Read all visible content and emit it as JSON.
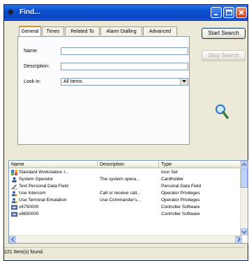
{
  "window": {
    "title": "Find..."
  },
  "tabs": [
    "General",
    "Times",
    "Related To",
    "Alarm Dialling",
    "Advanced"
  ],
  "form": {
    "name_label": "Name:",
    "name_value": "",
    "description_label": "Description:",
    "description_value": "",
    "lookin_label": "Look in:",
    "lookin_value": "All Items"
  },
  "buttons": {
    "start_search": "Start Search",
    "stop_search": "Stop Search"
  },
  "list": {
    "columns": [
      "Name",
      "Description",
      "Type"
    ],
    "rows": [
      {
        "name": "Standard Workstation I...",
        "description": "",
        "type": "Icon Set",
        "icon": "icon-set-icon"
      },
      {
        "name": "System Operator",
        "description": "The system opera...",
        "type": "Cardholder",
        "icon": "cardholder-icon"
      },
      {
        "name": "Text Personal Data Field",
        "description": "",
        "type": "Personal Data Field",
        "icon": "personal-data-field-icon"
      },
      {
        "name": "Use Intercom",
        "description": "Call or receive call...",
        "type": "Operator Privileges",
        "icon": "operator-privilege-icon"
      },
      {
        "name": "Use Terminal Emulation",
        "description": "Use Commander's...",
        "type": "Operator Privileges",
        "icon": "operator-privilege-icon"
      },
      {
        "name": "v8750000",
        "description": "",
        "type": "Controller Software",
        "icon": "controller-software-icon"
      },
      {
        "name": "v8850000",
        "description": "",
        "type": "Controller Software",
        "icon": "controller-software-icon"
      }
    ]
  },
  "status": {
    "text": "221 Item(s) found."
  }
}
